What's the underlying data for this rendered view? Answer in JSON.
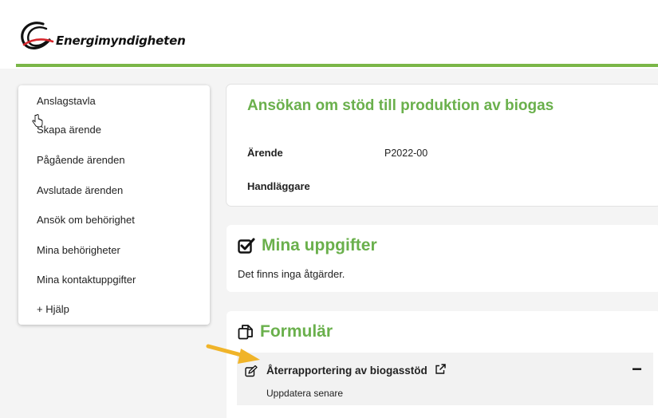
{
  "header": {
    "brand_name": "Energimyndigheten",
    "logo_icon": "energimyndigheten-logo",
    "accent_color": "#7ab648"
  },
  "sidebar": {
    "items": [
      {
        "label": "Anslagstavla"
      },
      {
        "label": "Skapa ärende"
      },
      {
        "label": "Pågående ärenden"
      },
      {
        "label": "Avslutade ärenden"
      },
      {
        "label": "Ansök om behörighet"
      },
      {
        "label": "Mina behörigheter"
      },
      {
        "label": "Mina kontaktuppgifter"
      },
      {
        "label": "+ Hjälp"
      }
    ]
  },
  "case": {
    "title": "Ansökan om stöd till produktion av biogas",
    "fields": [
      {
        "label": "Ärende",
        "value": "P2022-00"
      },
      {
        "label": "Handläggare",
        "value": ""
      }
    ]
  },
  "tasks": {
    "title": "Mina uppgifter",
    "icon": "checkbox-checked-icon",
    "empty_text": "Det finns inga åtgärder."
  },
  "forms": {
    "title": "Formulär",
    "icon": "copy-icon",
    "items": [
      {
        "title": "Återrapportering av biogasstöd",
        "subtitle": "Uppdatera senare",
        "edit_icon": "edit-icon",
        "link_icon": "external-link-icon",
        "collapse_symbol": "−"
      }
    ]
  },
  "annotation": {
    "arrow_icon": "pointer-arrow-icon",
    "arrow_color": "#f0b429"
  },
  "colors": {
    "title_green": "#6ab04c",
    "page_background": "#f4f4f4"
  }
}
